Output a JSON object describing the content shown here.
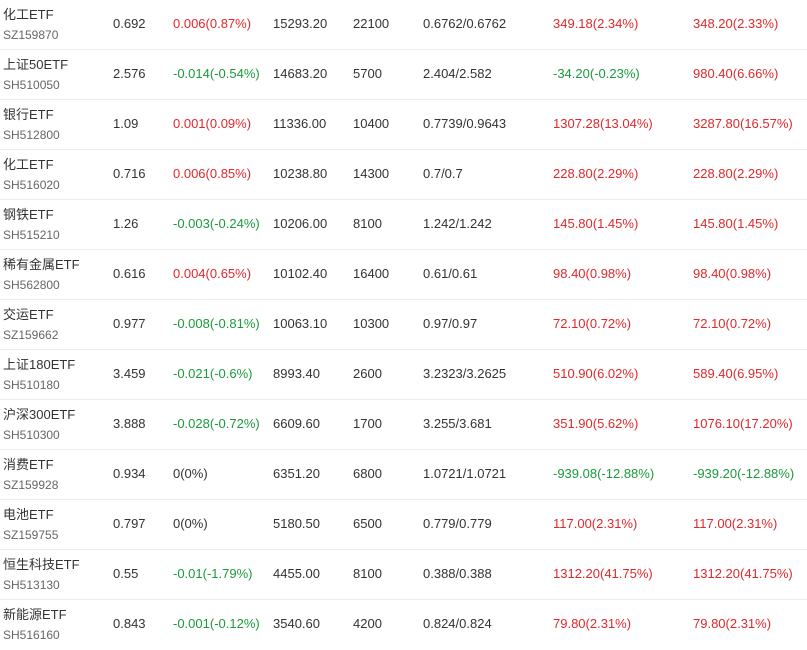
{
  "colors": {
    "up": "#e0282b",
    "down": "#1a9b3b",
    "flat": "#333333"
  },
  "rows": [
    {
      "name": "化工ETF",
      "code": "SZ159870",
      "price": "0.692",
      "change": "0.006(0.87%)",
      "change_dir": "up",
      "vol": "15293.20",
      "amount": "22100",
      "range": "0.6762/0.6762",
      "flow1": "349.18(2.34%)",
      "flow1_dir": "up",
      "flow2": "348.20(2.33%)",
      "flow2_dir": "up"
    },
    {
      "name": "上证50ETF",
      "code": "SH510050",
      "price": "2.576",
      "change": "-0.014(-0.54%)",
      "change_dir": "down",
      "vol": "14683.20",
      "amount": "5700",
      "range": "2.404/2.582",
      "flow1": "-34.20(-0.23%)",
      "flow1_dir": "down",
      "flow2": "980.40(6.66%)",
      "flow2_dir": "up"
    },
    {
      "name": "银行ETF",
      "code": "SH512800",
      "price": "1.09",
      "change": "0.001(0.09%)",
      "change_dir": "up",
      "vol": "11336.00",
      "amount": "10400",
      "range": "0.7739/0.9643",
      "flow1": "1307.28(13.04%)",
      "flow1_dir": "up",
      "flow2": "3287.80(16.57%)",
      "flow2_dir": "up"
    },
    {
      "name": "化工ETF",
      "code": "SH516020",
      "price": "0.716",
      "change": "0.006(0.85%)",
      "change_dir": "up",
      "vol": "10238.80",
      "amount": "14300",
      "range": "0.7/0.7",
      "flow1": "228.80(2.29%)",
      "flow1_dir": "up",
      "flow2": "228.80(2.29%)",
      "flow2_dir": "up"
    },
    {
      "name": "钢铁ETF",
      "code": "SH515210",
      "price": "1.26",
      "change": "-0.003(-0.24%)",
      "change_dir": "down",
      "vol": "10206.00",
      "amount": "8100",
      "range": "1.242/1.242",
      "flow1": "145.80(1.45%)",
      "flow1_dir": "up",
      "flow2": "145.80(1.45%)",
      "flow2_dir": "up"
    },
    {
      "name": "稀有金属ETF",
      "code": "SH562800",
      "price": "0.616",
      "change": "0.004(0.65%)",
      "change_dir": "up",
      "vol": "10102.40",
      "amount": "16400",
      "range": "0.61/0.61",
      "flow1": "98.40(0.98%)",
      "flow1_dir": "up",
      "flow2": "98.40(0.98%)",
      "flow2_dir": "up"
    },
    {
      "name": "交运ETF",
      "code": "SZ159662",
      "price": "0.977",
      "change": "-0.008(-0.81%)",
      "change_dir": "down",
      "vol": "10063.10",
      "amount": "10300",
      "range": "0.97/0.97",
      "flow1": "72.10(0.72%)",
      "flow1_dir": "up",
      "flow2": "72.10(0.72%)",
      "flow2_dir": "up"
    },
    {
      "name": "上证180ETF",
      "code": "SH510180",
      "price": "3.459",
      "change": "-0.021(-0.6%)",
      "change_dir": "down",
      "vol": "8993.40",
      "amount": "2600",
      "range": "3.2323/3.2625",
      "flow1": "510.90(6.02%)",
      "flow1_dir": "up",
      "flow2": "589.40(6.95%)",
      "flow2_dir": "up"
    },
    {
      "name": "沪深300ETF",
      "code": "SH510300",
      "price": "3.888",
      "change": "-0.028(-0.72%)",
      "change_dir": "down",
      "vol": "6609.60",
      "amount": "1700",
      "range": "3.255/3.681",
      "flow1": "351.90(5.62%)",
      "flow1_dir": "up",
      "flow2": "1076.10(17.20%)",
      "flow2_dir": "up"
    },
    {
      "name": "消费ETF",
      "code": "SZ159928",
      "price": "0.934",
      "change": "0(0%)",
      "change_dir": "flat",
      "vol": "6351.20",
      "amount": "6800",
      "range": "1.0721/1.0721",
      "flow1": "-939.08(-12.88%)",
      "flow1_dir": "down",
      "flow2": "-939.20(-12.88%)",
      "flow2_dir": "down"
    },
    {
      "name": "电池ETF",
      "code": "SZ159755",
      "price": "0.797",
      "change": "0(0%)",
      "change_dir": "flat",
      "vol": "5180.50",
      "amount": "6500",
      "range": "0.779/0.779",
      "flow1": "117.00(2.31%)",
      "flow1_dir": "up",
      "flow2": "117.00(2.31%)",
      "flow2_dir": "up"
    },
    {
      "name": "恒生科技ETF",
      "code": "SH513130",
      "price": "0.55",
      "change": "-0.01(-1.79%)",
      "change_dir": "down",
      "vol": "4455.00",
      "amount": "8100",
      "range": "0.388/0.388",
      "flow1": "1312.20(41.75%)",
      "flow1_dir": "up",
      "flow2": "1312.20(41.75%)",
      "flow2_dir": "up"
    },
    {
      "name": "新能源ETF",
      "code": "SH516160",
      "price": "0.843",
      "change": "-0.001(-0.12%)",
      "change_dir": "down",
      "vol": "3540.60",
      "amount": "4200",
      "range": "0.824/0.824",
      "flow1": "79.80(2.31%)",
      "flow1_dir": "up",
      "flow2": "79.80(2.31%)",
      "flow2_dir": "up"
    }
  ]
}
